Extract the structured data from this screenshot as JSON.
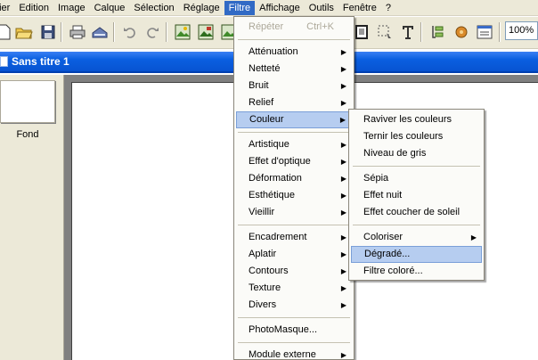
{
  "menubar": {
    "items": [
      "nier",
      "Edition",
      "Image",
      "Calque",
      "Sélection",
      "Réglage",
      "Filtre",
      "Affichage",
      "Outils",
      "Fenêtre",
      "?"
    ],
    "active_index": 6
  },
  "toolbar": {
    "zoom_value": "100%",
    "icons": [
      "new-document-icon",
      "open-folder-icon",
      "save-icon",
      "print-icon",
      "scanner-icon",
      "undo-icon",
      "redo-icon",
      "image-effect-icon",
      "image-effect-2-icon",
      "image-effect-3-icon",
      "text-icon",
      "layers-icon",
      "plugin-icon",
      "window-icon"
    ]
  },
  "document": {
    "title": "Sans titre 1"
  },
  "layers": {
    "items": [
      {
        "label": "Fond"
      }
    ]
  },
  "filtre_menu": {
    "groups": [
      [
        {
          "label": "Répéter",
          "shortcut": "Ctrl+K",
          "disabled": true
        }
      ],
      [
        {
          "label": "Atténuation",
          "submenu": true
        },
        {
          "label": "Netteté",
          "submenu": true
        },
        {
          "label": "Bruit",
          "submenu": true
        },
        {
          "label": "Relief",
          "submenu": true
        },
        {
          "label": "Couleur",
          "submenu": true,
          "selected": true
        }
      ],
      [
        {
          "label": "Artistique",
          "submenu": true
        },
        {
          "label": "Effet d'optique",
          "submenu": true
        },
        {
          "label": "Déformation",
          "submenu": true
        },
        {
          "label": "Esthétique",
          "submenu": true
        },
        {
          "label": "Vieillir",
          "submenu": true
        }
      ],
      [
        {
          "label": "Encadrement",
          "submenu": true
        },
        {
          "label": "Aplatir",
          "submenu": true
        },
        {
          "label": "Contours",
          "submenu": true
        },
        {
          "label": "Texture",
          "submenu": true
        },
        {
          "label": "Divers",
          "submenu": true
        }
      ],
      [
        {
          "label": "PhotoMasque..."
        }
      ],
      [
        {
          "label": "Module externe",
          "submenu": true
        }
      ]
    ]
  },
  "couleur_submenu": {
    "groups": [
      [
        {
          "label": "Raviver les couleurs"
        },
        {
          "label": "Ternir les couleurs"
        },
        {
          "label": "Niveau de gris"
        }
      ],
      [
        {
          "label": "Sépia"
        },
        {
          "label": "Effet nuit"
        },
        {
          "label": "Effet coucher de soleil"
        }
      ],
      [
        {
          "label": "Coloriser",
          "submenu": true
        },
        {
          "label": "Dégradé...",
          "selected": true
        },
        {
          "label": "Filtre coloré..."
        }
      ]
    ]
  },
  "colors": {
    "menu_highlight": "#316ac5",
    "title_bar": "#0a5fe0",
    "item_selected": "#b6cdf0",
    "workspace": "#ece9d8",
    "canvas_surround": "#808080"
  }
}
